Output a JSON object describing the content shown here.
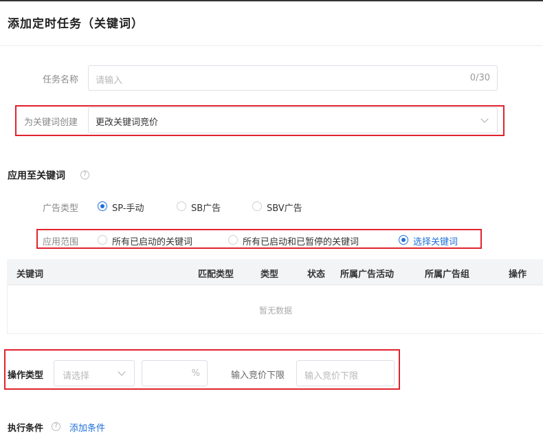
{
  "title": "添加定时任务（关键词）",
  "task_name": {
    "label": "任务名称",
    "placeholder": "请输入",
    "counter": "0/30"
  },
  "create_for": {
    "label": "为关键词创建",
    "value": "更改关键词竞价"
  },
  "apply_section": {
    "title": "应用至关键词",
    "help_icon": "question-circle-icon"
  },
  "ad_type": {
    "label": "广告类型",
    "options": [
      {
        "label": "SP-手动",
        "checked": true
      },
      {
        "label": "SB广告",
        "checked": false
      },
      {
        "label": "SBV广告",
        "checked": false
      }
    ]
  },
  "scope": {
    "label": "应用范围",
    "options": [
      {
        "label": "所有已启动的关键词",
        "checked": false
      },
      {
        "label": "所有已启动和已暂停的关键词",
        "checked": false
      },
      {
        "label": "选择关键词",
        "checked": true
      }
    ]
  },
  "table": {
    "columns": [
      "关键词",
      "匹配类型",
      "类型",
      "状态",
      "所属广告活动",
      "所属广告组",
      "操作"
    ],
    "empty_text": "暂无数据"
  },
  "operation": {
    "label": "操作类型",
    "select_placeholder": "请选择",
    "percent_suffix": "%",
    "lower_label": "输入竞价下限",
    "lower_placeholder": "输入竞价下限"
  },
  "conditions": {
    "label": "执行条件",
    "help_icon": "question-circle-icon",
    "add_link": "添加条件"
  },
  "colors": {
    "accent": "#1e6fd9",
    "highlight": "#e0222d"
  }
}
